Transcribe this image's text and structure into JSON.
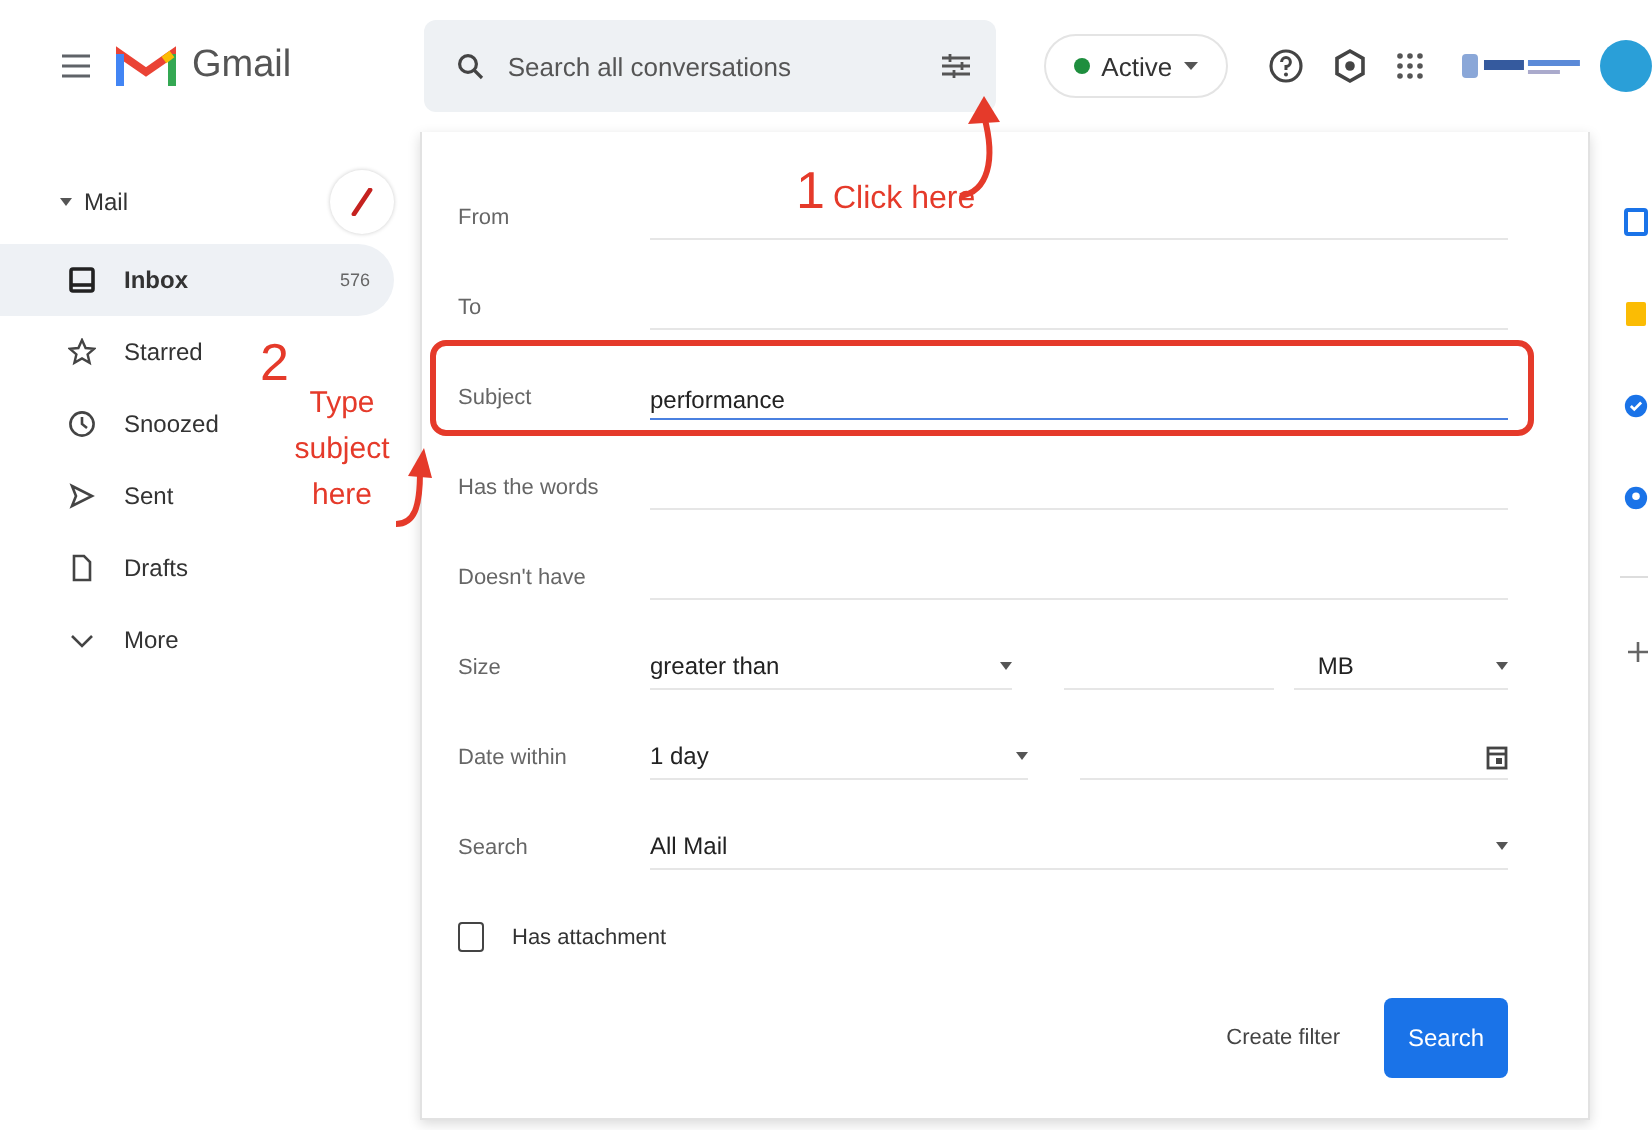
{
  "header": {
    "app_name": "Gmail",
    "search_placeholder": "Search all conversations",
    "status": {
      "label": "Active",
      "color": "#1e8e3e"
    }
  },
  "sidebar": {
    "section": "Mail",
    "items": [
      {
        "kind": "inbox",
        "label": "Inbox",
        "count": "576",
        "selected": true
      },
      {
        "kind": "star",
        "label": "Starred",
        "selected": false
      },
      {
        "kind": "clock",
        "label": "Snoozed",
        "selected": false
      },
      {
        "kind": "send",
        "label": "Sent",
        "selected": false
      },
      {
        "kind": "draft",
        "label": "Drafts",
        "selected": false
      },
      {
        "kind": "more",
        "label": "More",
        "selected": false
      }
    ]
  },
  "filter": {
    "rows": [
      {
        "kind": "text",
        "label": "From",
        "focused": false
      },
      {
        "kind": "text",
        "label": "To",
        "focused": false
      },
      {
        "kind": "text",
        "label": "Subject",
        "value": "performance",
        "focused": true
      },
      {
        "kind": "text",
        "label": "Has the words",
        "focused": false
      },
      {
        "kind": "text",
        "label": "Doesn't have",
        "focused": false
      },
      {
        "kind": "size",
        "label": "Size",
        "value": "greater than",
        "unit": "MB"
      },
      {
        "kind": "date",
        "label": "Date within",
        "value": "1 day"
      },
      {
        "kind": "select",
        "label": "Search",
        "value": "All Mail"
      }
    ],
    "attachment": {
      "label": "Has attachment",
      "checked": false
    },
    "buttons": {
      "create_filter": "Create filter",
      "search": "Search"
    }
  },
  "annotations": [
    {
      "kind": "filter",
      "number": "1",
      "text": "Click here"
    },
    {
      "kind": "subject",
      "number": "2",
      "text": "Type subject here"
    }
  ]
}
